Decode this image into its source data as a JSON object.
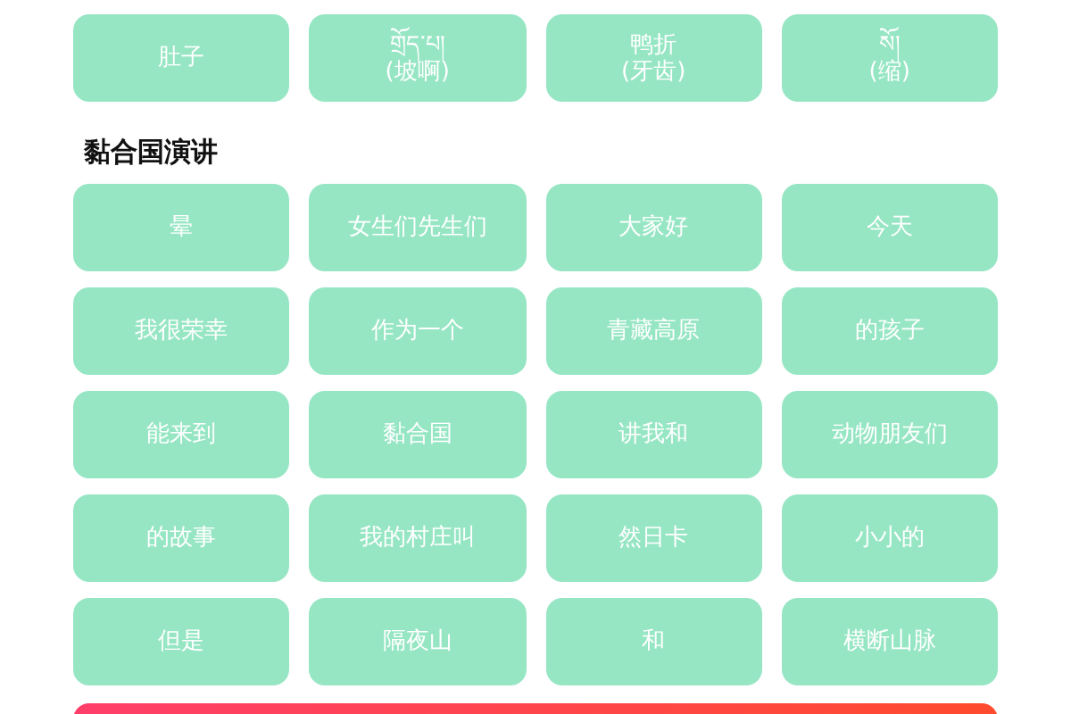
{
  "top_tiles": [
    {
      "lines": [
        "肚子"
      ]
    },
    {
      "lines": [
        "གྲོད་པ།",
        "(坡啊)"
      ]
    },
    {
      "lines": [
        "鸭折",
        "(牙齿)"
      ]
    },
    {
      "lines": [
        "སོ།",
        "(缩)"
      ]
    }
  ],
  "section": {
    "title": "黏合国演讲",
    "tiles": [
      "晕",
      "女生们先生们",
      "大家好",
      "今天",
      "我很荣幸",
      "作为一个",
      "青藏高原",
      "的孩子",
      "能来到",
      "黏合国",
      "讲我和",
      "动物朋友们",
      "的故事",
      "我的村庄叫",
      "然日卡",
      "小小的",
      "但是",
      "隔夜山",
      "和",
      "横断山脉"
    ]
  },
  "bottom_bar": {
    "kind": "gradient"
  }
}
